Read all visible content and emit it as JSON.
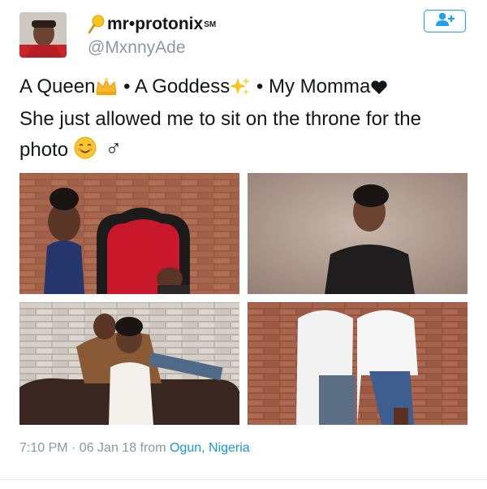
{
  "user": {
    "display_name": "mr•protonix",
    "name_suffix": "SM",
    "handle": "@MxnnyAde",
    "avatar_icon": "person-avatar",
    "name_icon": "pin-icon"
  },
  "follow_button": {
    "icon": "add-user-icon"
  },
  "tweet": {
    "line1_a": "A Queen",
    "line1_b": " • A Goddess",
    "line1_c": " • My Momma",
    "line2": "She just allowed me to sit on the throne for the",
    "line3": "photo",
    "emojis": [
      "crown",
      "sparkles",
      "heart",
      "blush",
      "male-sign"
    ],
    "male_sign": "♂"
  },
  "photos": [
    {
      "name": "photo-throne",
      "description_icon": "photo"
    },
    {
      "name": "photo-mother-portrait",
      "description_icon": "photo"
    },
    {
      "name": "photo-couch",
      "description_icon": "photo"
    },
    {
      "name": "photo-couple",
      "description_icon": "photo"
    }
  ],
  "meta": {
    "time_date": "7:10 PM · 06 Jan 18 from ",
    "place": "Ogun, Nigeria"
  },
  "colors": {
    "accent": "#1da1f2",
    "link": "#1b95e0",
    "muted": "#8899a6",
    "heart": "#14171a"
  }
}
